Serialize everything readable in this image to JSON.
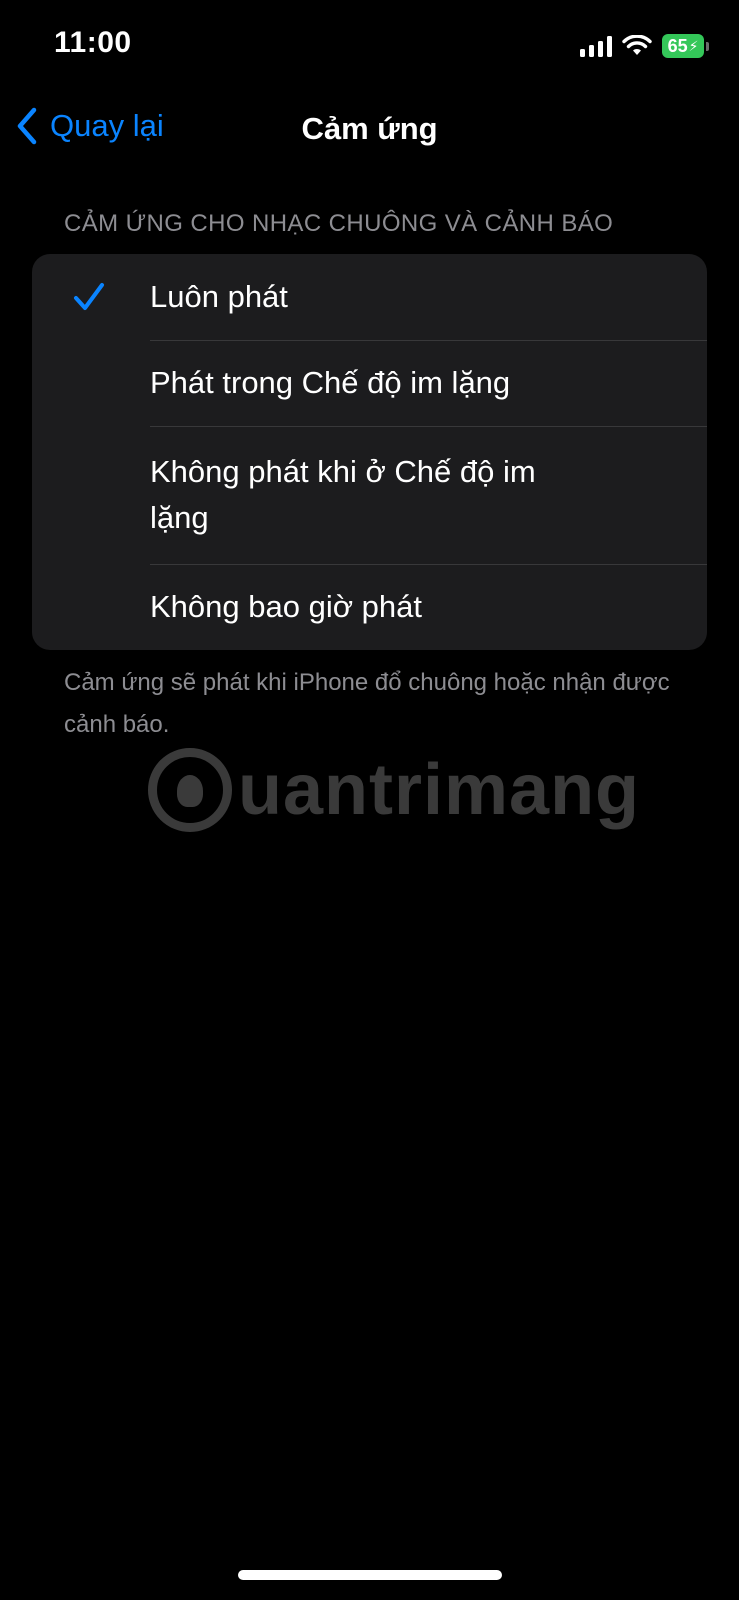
{
  "status_bar": {
    "time": "11:00",
    "battery_level": "65",
    "icons": [
      "signal-icon",
      "wifi-icon",
      "battery-charging-icon"
    ],
    "battery_color": "#34c759"
  },
  "nav": {
    "back_label": "Quay lại",
    "title": "Cảm ứng",
    "accent_color": "#0a84ff"
  },
  "section": {
    "header": "CẢM ỨNG CHO NHẠC CHUÔNG VÀ CẢNH BÁO",
    "options": [
      {
        "label": "Luôn phát",
        "selected": true
      },
      {
        "label": "Phát trong Chế độ im lặng",
        "selected": false
      },
      {
        "label": "Không phát khi ở Chế độ im lặng",
        "selected": false
      },
      {
        "label": "Không bao giờ phát",
        "selected": false
      }
    ],
    "footer": "Cảm ứng sẽ phát khi iPhone đổ chuông hoặc nhận được cảnh báo."
  },
  "watermark": {
    "text": "uantrimang"
  }
}
